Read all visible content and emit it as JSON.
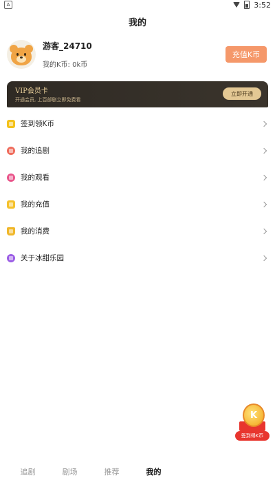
{
  "status_bar": {
    "time": "3:52",
    "sim_label": "A"
  },
  "header": {
    "title": "我的"
  },
  "profile": {
    "username": "游客_24710",
    "kcoin_label": "我的K币: 0k币",
    "recharge_label": "充值K币"
  },
  "vip": {
    "title": "VIP会员卡",
    "subtitle": "开通会员, 上百部剧立即免费看",
    "button": "立即开通"
  },
  "menu": {
    "items": [
      {
        "label": "签到领K币",
        "icon": "checkin-icon"
      },
      {
        "label": "我的追剧",
        "icon": "follow-icon"
      },
      {
        "label": "我的观看",
        "icon": "history-icon"
      },
      {
        "label": "我的充值",
        "icon": "recharge-icon"
      },
      {
        "label": "我的消费",
        "icon": "spend-icon"
      },
      {
        "label": "关于冰甜乐园",
        "icon": "info-icon"
      }
    ]
  },
  "reward": {
    "label": "签到得K币",
    "coin_text": "K"
  },
  "tabs": [
    {
      "label": "追剧",
      "active": false
    },
    {
      "label": "剧场",
      "active": false
    },
    {
      "label": "推荐",
      "active": false
    },
    {
      "label": "我的",
      "active": true
    }
  ],
  "colors": {
    "accent": "#f5986a",
    "vip_bg": "#2f2a24",
    "vip_gold": "#e3c894"
  }
}
